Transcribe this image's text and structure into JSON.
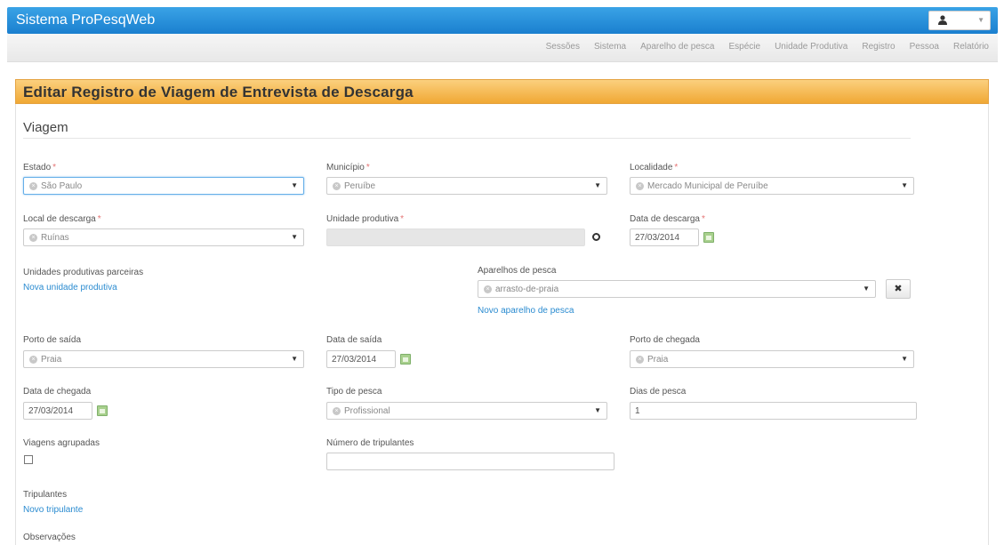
{
  "app": {
    "brand": "Sistema ProPesqWeb"
  },
  "nav": [
    "Sessões",
    "Sistema",
    "Aparelho de pesca",
    "Espécie",
    "Unidade Produtiva",
    "Registro",
    "Pessoa",
    "Relatório"
  ],
  "page": {
    "title": "Editar Registro de Viagem de Entrevista de Descarga",
    "section": "Viagem"
  },
  "fields": {
    "estado": {
      "label": "Estado",
      "value": "São Paulo"
    },
    "municipio": {
      "label": "Município",
      "value": "Peruíbe"
    },
    "localidade": {
      "label": "Localidade",
      "value": "Mercado Municipal de Peruíbe"
    },
    "local_descarga": {
      "label": "Local de descarga",
      "value": "Ruínas"
    },
    "unidade_produtiva": {
      "label": "Unidade produtiva",
      "value": ""
    },
    "data_descarga": {
      "label": "Data de descarga",
      "value": "27/03/2014"
    },
    "unidades_parceiras": {
      "label": "Unidades produtivas parceiras",
      "link": "Nova unidade produtiva"
    },
    "aparelhos": {
      "label": "Aparelhos de pesca",
      "value": "arrasto-de-praia",
      "link": "Novo aparelho de pesca",
      "remove": "✖"
    },
    "porto_saida": {
      "label": "Porto de saída",
      "value": "Praia"
    },
    "data_saida": {
      "label": "Data de saída",
      "value": "27/03/2014"
    },
    "porto_chegada": {
      "label": "Porto de chegada",
      "value": "Praia"
    },
    "data_chegada": {
      "label": "Data de chegada",
      "value": "27/03/2014"
    },
    "tipo_pesca": {
      "label": "Tipo de pesca",
      "value": "Profissional"
    },
    "dias_pesca": {
      "label": "Dias de pesca",
      "value": "1"
    },
    "viagens_agrupadas": {
      "label": "Viagens agrupadas"
    },
    "numero_tripulantes": {
      "label": "Número de tripulantes",
      "value": ""
    },
    "tripulantes": {
      "label": "Tripulantes",
      "link": "Novo tripulante"
    },
    "observacoes": {
      "label": "Observações"
    }
  },
  "required_mark": "*",
  "icons": {
    "clear": "×",
    "caret": "▼",
    "user": "user-icon",
    "calendar": "calendar-icon"
  }
}
